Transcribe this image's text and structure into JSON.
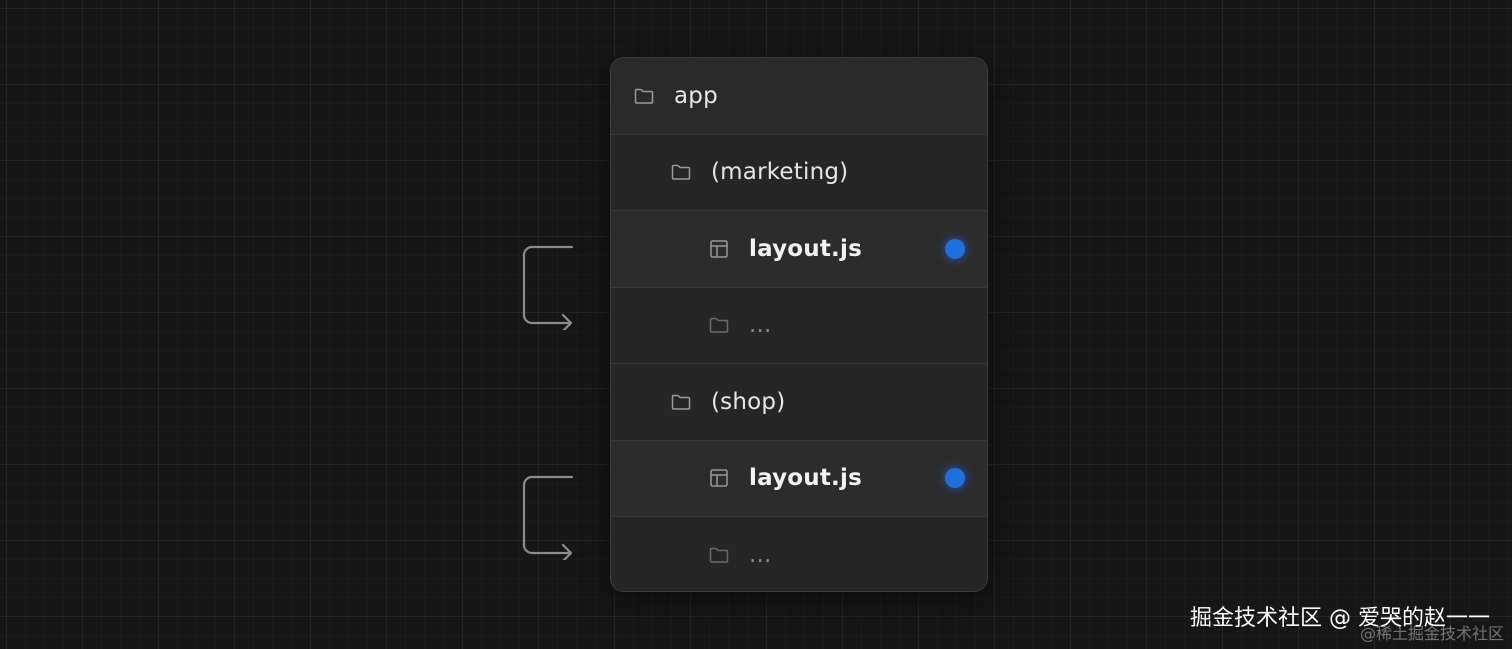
{
  "tree": {
    "items": [
      {
        "label": "app",
        "kind": "folder",
        "depth": 0,
        "bold": false,
        "marked": false,
        "dim": false
      },
      {
        "label": "(marketing)",
        "kind": "folder",
        "depth": 1,
        "bold": false,
        "marked": false,
        "dim": false
      },
      {
        "label": "layout.js",
        "kind": "layout-file",
        "depth": 2,
        "bold": true,
        "marked": true,
        "dim": false
      },
      {
        "label": "...",
        "kind": "folder",
        "depth": 2,
        "bold": false,
        "marked": false,
        "dim": true
      },
      {
        "label": "(shop)",
        "kind": "folder",
        "depth": 1,
        "bold": false,
        "marked": false,
        "dim": false
      },
      {
        "label": "layout.js",
        "kind": "layout-file",
        "depth": 2,
        "bold": true,
        "marked": true,
        "dim": false
      },
      {
        "label": "...",
        "kind": "folder",
        "depth": 2,
        "bold": false,
        "marked": false,
        "dim": true
      }
    ]
  },
  "colors": {
    "background": "#161616",
    "panel": "#262626",
    "marker_dot": "#1e6fe0",
    "arrow": "#8c8c8c"
  },
  "watermark": {
    "text": "掘金技术社区 @ 爱哭的赵一一",
    "subtext": "@稀土掘金技术社区"
  }
}
